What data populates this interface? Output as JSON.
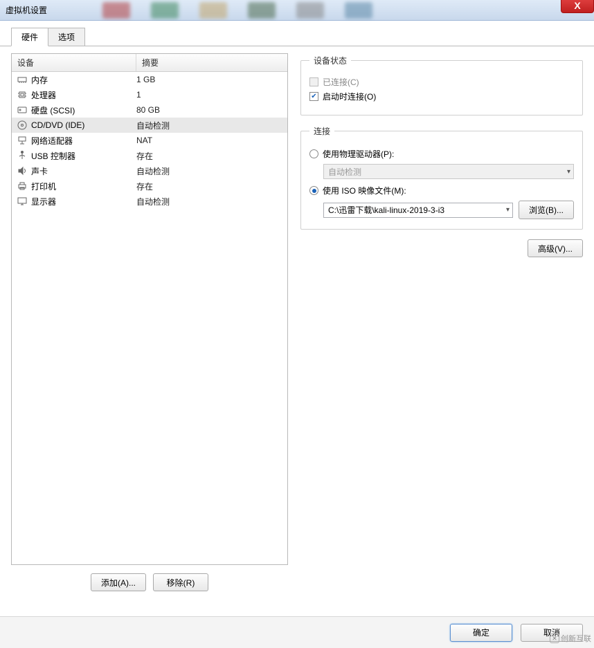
{
  "window": {
    "title": "虚拟机设置",
    "close": "X"
  },
  "tabs": {
    "hardware": "硬件",
    "options": "选项"
  },
  "headers": {
    "device": "设备",
    "summary": "摘要"
  },
  "devices": [
    {
      "name": "内存",
      "summary": "1 GB",
      "icon": "memory-icon"
    },
    {
      "name": "处理器",
      "summary": "1",
      "icon": "cpu-icon"
    },
    {
      "name": "硬盘 (SCSI)",
      "summary": "80 GB",
      "icon": "disk-icon"
    },
    {
      "name": "CD/DVD (IDE)",
      "summary": "自动检测",
      "icon": "cd-icon",
      "selected": true
    },
    {
      "name": "网络适配器",
      "summary": "NAT",
      "icon": "network-icon"
    },
    {
      "name": "USB 控制器",
      "summary": "存在",
      "icon": "usb-icon"
    },
    {
      "name": "声卡",
      "summary": "自动检测",
      "icon": "sound-icon"
    },
    {
      "name": "打印机",
      "summary": "存在",
      "icon": "printer-icon"
    },
    {
      "name": "显示器",
      "summary": "自动检测",
      "icon": "display-icon"
    }
  ],
  "left_buttons": {
    "add": "添加(A)...",
    "remove": "移除(R)"
  },
  "status_box": {
    "legend": "设备状态",
    "connected": "已连接(C)",
    "connect_at_poweron": "启动时连接(O)"
  },
  "connect_box": {
    "legend": "连接",
    "physical": "使用物理驱动器(P):",
    "physical_combo": "自动检测",
    "iso": "使用 ISO 映像文件(M):",
    "iso_path": "C:\\迅雷下载\\kali-linux-2019-3-i3",
    "browse": "浏览(B)..."
  },
  "advanced": "高级(V)...",
  "bottom": {
    "ok": "确定",
    "cancel": "取消"
  },
  "watermark": "创新互联"
}
